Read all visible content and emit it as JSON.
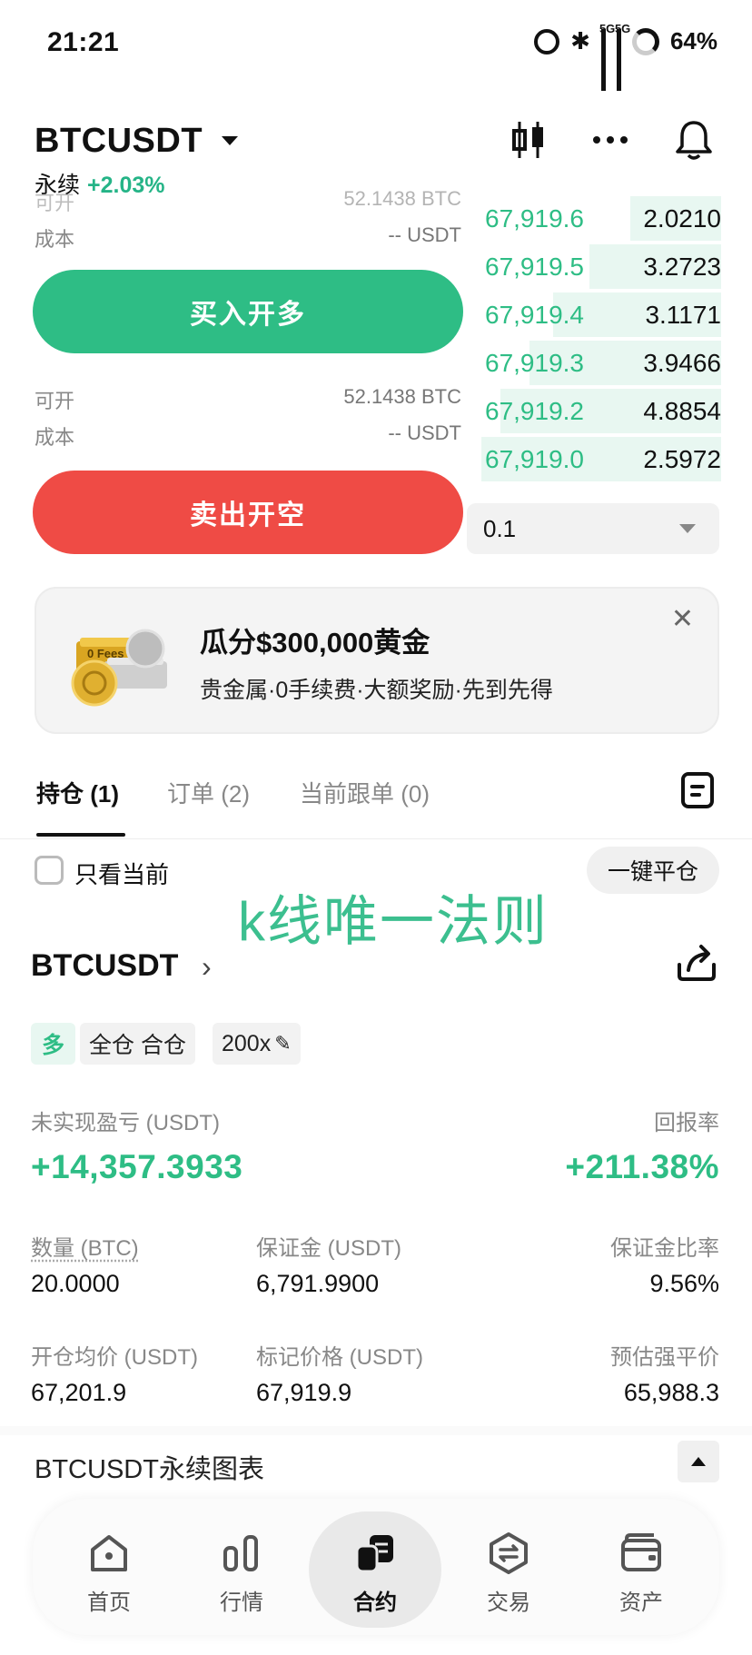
{
  "status_bar": {
    "time": "21:21",
    "battery": "64%",
    "signal_1": "5G",
    "signal_2": "5G",
    "icons": [
      "alarm-icon",
      "bluetooth-icon",
      "signal-5g-icon",
      "signal-5g-icon",
      "battery-ring-icon"
    ]
  },
  "header": {
    "pair": "BTCUSDT",
    "type": "永续",
    "change": "+2.03%",
    "icons": [
      "candlestick-icon",
      "more-icon",
      "bell-icon"
    ]
  },
  "trade": {
    "faded_available_label": "可开",
    "faded_available_value": "52.1438 BTC",
    "faded_cost_label": "成本",
    "faded_cost_value": "-- USDT",
    "buy_label": "买入开多",
    "available_label": "可开",
    "available_value": "52.1438 BTC",
    "cost_label": "成本",
    "cost_value": "-- USDT",
    "sell_label": "卖出开空",
    "qty_value": "0.1"
  },
  "orderbook": {
    "rows": [
      {
        "price": "67,919.6",
        "qty": "2.0210",
        "depth": 0.38
      },
      {
        "price": "67,919.5",
        "qty": "3.2723",
        "depth": 0.55
      },
      {
        "price": "67,919.4",
        "qty": "3.1171",
        "depth": 0.7
      },
      {
        "price": "67,919.3",
        "qty": "3.9466",
        "depth": 0.8
      },
      {
        "price": "67,919.2",
        "qty": "4.8854",
        "depth": 0.92
      },
      {
        "price": "67,919.0",
        "qty": "2.5972",
        "depth": 1.0
      }
    ]
  },
  "promo": {
    "title": "瓜分$300,000黄金",
    "subtitle": "贵金属·0手续费·大额奖励·先到先得",
    "art_text": "0 Fees"
  },
  "tabs": [
    {
      "label": "持仓 (1)",
      "active": true
    },
    {
      "label": "订单 (2)",
      "active": false
    },
    {
      "label": "当前跟单 (0)",
      "active": false
    }
  ],
  "filter": {
    "only_current": "只看当前",
    "close_all": "一键平仓"
  },
  "watermark": "k线唯一法则",
  "position": {
    "pair": "BTCUSDT",
    "side": "多",
    "mode": "全仓 合仓",
    "leverage": "200x",
    "upnl_label": "未实现盈亏 (USDT)",
    "upnl_value": "+14,357.3933",
    "roe_label": "回报率",
    "roe_value": "+211.38%",
    "qty_label": "数量 (BTC)",
    "qty_value": "20.0000",
    "margin_label": "保证金 (USDT)",
    "margin_value": "6,791.9900",
    "margin_ratio_label": "保证金比率",
    "margin_ratio_value": "9.56%",
    "entry_label": "开仓均价 (USDT)",
    "entry_value": "67,201.9",
    "mark_label": "标记价格 (USDT)",
    "mark_value": "67,919.9",
    "liq_label": "预估强平价",
    "liq_value": "65,988.3"
  },
  "chart_section": {
    "title": "BTCUSDT永续图表"
  },
  "nav": [
    {
      "label": "首页",
      "icon": "home-icon"
    },
    {
      "label": "行情",
      "icon": "market-icon"
    },
    {
      "label": "合约",
      "icon": "futures-icon",
      "active": true
    },
    {
      "label": "交易",
      "icon": "trade-icon"
    },
    {
      "label": "资产",
      "icon": "wallet-icon"
    }
  ],
  "colors": {
    "green": "#2ebd85",
    "red": "#ef4b45",
    "watermark": "#3cbf8f"
  }
}
